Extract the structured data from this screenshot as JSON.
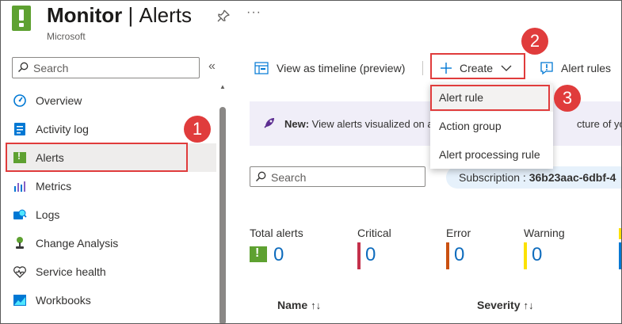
{
  "header": {
    "title": "Monitor",
    "section": "Alerts",
    "subtitle": "Microsoft",
    "more": "···"
  },
  "sidebar": {
    "search_placeholder": "Search",
    "collapse": "«",
    "items": [
      {
        "label": "Overview",
        "icon": "overview-icon"
      },
      {
        "label": "Activity log",
        "icon": "activity-log-icon"
      },
      {
        "label": "Alerts",
        "icon": "alerts-icon",
        "active": true
      },
      {
        "label": "Metrics",
        "icon": "metrics-icon"
      },
      {
        "label": "Logs",
        "icon": "logs-icon"
      },
      {
        "label": "Change Analysis",
        "icon": "change-analysis-icon"
      },
      {
        "label": "Service health",
        "icon": "service-health-icon"
      },
      {
        "label": "Workbooks",
        "icon": "workbooks-icon"
      }
    ]
  },
  "toolbar": {
    "timeline": "View as timeline (preview)",
    "create": "Create",
    "alert_rules": "Alert rules"
  },
  "create_menu": {
    "items": [
      "Alert rule",
      "Action group",
      "Alert processing rule"
    ]
  },
  "banner": {
    "bold": "New:",
    "text": " View alerts visualized on a",
    "text_tail": "cture of your ev"
  },
  "filters": {
    "search_placeholder": "Search",
    "subscription_label": "Subscription : ",
    "subscription_value": "36b23aac-6dbf-4"
  },
  "summary": {
    "total": {
      "label": "Total alerts",
      "value": "0"
    },
    "critical": {
      "label": "Critical",
      "value": "0"
    },
    "error": {
      "label": "Error",
      "value": "0"
    },
    "warning": {
      "label": "Warning",
      "value": "0"
    }
  },
  "table": {
    "columns": [
      "Name",
      "Severity"
    ],
    "sort_glyph": "↑↓"
  },
  "callouts": [
    "1",
    "2",
    "3"
  ],
  "colors": {
    "accent": "#0f6cbd",
    "callout": "#e03c3c",
    "alerts_green": "#5ea131",
    "critical": "#c4314b",
    "error": "#ca5010",
    "warning": "#fce100"
  }
}
